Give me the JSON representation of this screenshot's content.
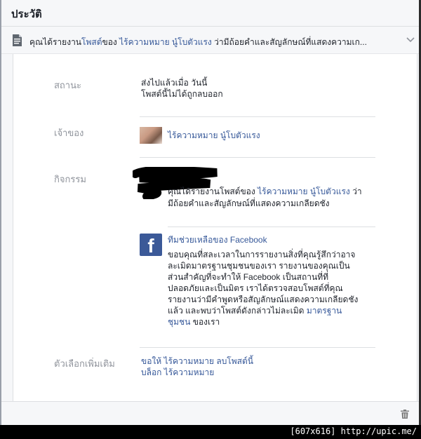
{
  "header": {
    "title": "ประวัติ"
  },
  "report_row": {
    "prefix": "คุณได้รายงาน",
    "post_link": "โพสต์",
    "mid": "ของ ",
    "owner_link": "ไร้ความหมาย นู๋โบตัวแรง",
    "suffix": " ว่ามีถ้อยคำและสัญลักษณ์ที่แสดงความเก..."
  },
  "status": {
    "label": "สถานะ",
    "line1": "ส่งไปแล้วเมื่อ วันนี้",
    "line2": "โพสต์นี้ไม่ได้ถูกลบออก"
  },
  "owner": {
    "label": "เจ้าของ",
    "name": "ไร้ความหมาย นู๋โบตัวแรง"
  },
  "activity": {
    "label": "กิจกรรม",
    "report_prefix": "คุณได้รายงานโพสต์ของ ",
    "report_owner": "ไร้ความหมาย นู๋โบตัวแรง",
    "report_mid": " ว่า",
    "report_line2": "มีถ้อยคำและสัญลักษณ์ที่แสดงความเกลียดชัง",
    "team_name": "ทีมช่วยเหลือของ Facebook",
    "msg_lines": [
      "ขอบคุณที่สละเวลาในการรายงานสิ่งที่คุณรู้สึกว่าอาจ",
      "ละเมิดมาตรฐานชุมชนของเรา รายงานของคุณเป็น",
      "ส่วนสำคัญที่จะทำให้ Facebook เป็นสถานที่ที่",
      "ปลอดภัยและเป็นมิตร เราได้ตรวจสอบโพสต์ที่คุณ",
      "รายงานว่ามีคำพูดหรือสัญลักษณ์แสดงความเกลียดชัง",
      "แล้ว และพบว่าโพสต์ดังกล่าวไม่ละเมิด "
    ],
    "msg_link1": "มาตรฐาน",
    "msg_link2": "ชุมชน",
    "msg_end": " ของเรา",
    "fb_letter": "f"
  },
  "more_options": {
    "label": "ตัวเลือกเพิ่มเติม",
    "option1_prefix": "ขอให้ ",
    "option1_user": "ไร้ความหมาย",
    "option1_action": " ลบโพสต์นี้",
    "option2": "บล็อก ไร้ความหมาย"
  },
  "watermark": "[607x616] http://upic.me/",
  "colors": {
    "link": "#365899",
    "muted": "#90949c",
    "fb_blue": "#3b5998"
  },
  "icons": [
    "document-icon",
    "chevron-down-icon",
    "facebook-logo-icon",
    "trash-icon"
  ]
}
